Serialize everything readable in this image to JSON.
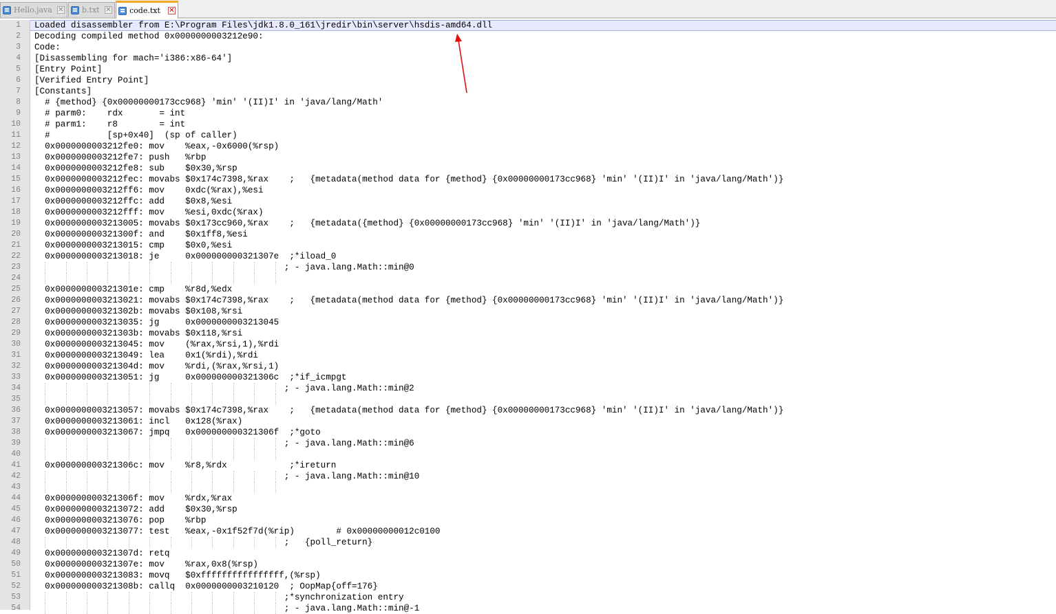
{
  "tabs": [
    {
      "label": "Hello.java",
      "active": false
    },
    {
      "label": "b.txt",
      "active": false
    },
    {
      "label": "code.txt",
      "active": true
    }
  ],
  "colors": {
    "annotation_arrow": "#e01010",
    "active_tab_accent": "#f5a623",
    "caret_line": "#e8e8ff"
  },
  "icons": {
    "file": "file-icon",
    "close": "close-x-icon"
  },
  "lines": [
    "Loaded disassembler from E:\\Program Files\\jdk1.8.0_161\\jredir\\bin\\server\\hsdis-amd64.dll",
    "Decoding compiled method 0x0000000003212e90:",
    "Code:",
    "[Disassembling for mach='i386:x86-64']",
    "[Entry Point]",
    "[Verified Entry Point]",
    "[Constants]",
    "  # {method} {0x00000000173cc968} 'min' '(II)I' in 'java/lang/Math'",
    "  # parm0:    rdx       = int",
    "  # parm1:    r8        = int",
    "  #           [sp+0x40]  (sp of caller)",
    "  0x0000000003212fe0: mov    %eax,-0x6000(%rsp)",
    "  0x0000000003212fe7: push   %rbp",
    "  0x0000000003212fe8: sub    $0x30,%rsp",
    "  0x0000000003212fec: movabs $0x174c7398,%rax    ;   {metadata(method data for {method} {0x00000000173cc968} 'min' '(II)I' in 'java/lang/Math')}",
    "  0x0000000003212ff6: mov    0xdc(%rax),%esi",
    "  0x0000000003212ffc: add    $0x8,%esi",
    "  0x0000000003212fff: mov    %esi,0xdc(%rax)",
    "  0x0000000003213005: movabs $0x173cc960,%rax    ;   {metadata({method} {0x00000000173cc968} 'min' '(II)I' in 'java/lang/Math')}",
    "  0x000000000321300f: and    $0x1ff8,%esi",
    "  0x0000000003213015: cmp    $0x0,%esi",
    "  0x0000000003213018: je     0x000000000321307e  ;*iload_0",
    "                                                ; - java.lang.Math::min@0",
    "",
    "  0x000000000321301e: cmp    %r8d,%edx",
    "  0x0000000003213021: movabs $0x174c7398,%rax    ;   {metadata(method data for {method} {0x00000000173cc968} 'min' '(II)I' in 'java/lang/Math')}",
    "  0x000000000321302b: movabs $0x108,%rsi",
    "  0x0000000003213035: jg     0x0000000003213045",
    "  0x000000000321303b: movabs $0x118,%rsi",
    "  0x0000000003213045: mov    (%rax,%rsi,1),%rdi",
    "  0x0000000003213049: lea    0x1(%rdi),%rdi",
    "  0x000000000321304d: mov    %rdi,(%rax,%rsi,1)",
    "  0x0000000003213051: jg     0x000000000321306c  ;*if_icmpgt",
    "                                                ; - java.lang.Math::min@2",
    "",
    "  0x0000000003213057: movabs $0x174c7398,%rax    ;   {metadata(method data for {method} {0x00000000173cc968} 'min' '(II)I' in 'java/lang/Math')}",
    "  0x0000000003213061: incl   0x128(%rax)",
    "  0x0000000003213067: jmpq   0x000000000321306f  ;*goto",
    "                                                ; - java.lang.Math::min@6",
    "",
    "  0x000000000321306c: mov    %r8,%rdx            ;*ireturn",
    "                                                ; - java.lang.Math::min@10",
    "",
    "  0x000000000321306f: mov    %rdx,%rax",
    "  0x0000000003213072: add    $0x30,%rsp",
    "  0x0000000003213076: pop    %rbp",
    "  0x0000000003213077: test   %eax,-0x1f52f7d(%rip)        # 0x00000000012c0100",
    "                                                ;   {poll_return}",
    "  0x000000000321307d: retq",
    "  0x000000000321307e: mov    %rax,0x8(%rsp)",
    "  0x0000000003213083: movq   $0xffffffffffffffff,(%rsp)",
    "  0x000000000321308b: callq  0x0000000003210120  ; OopMap{off=176}",
    "                                                ;*synchronization entry",
    "                                                ; - java.lang.Math::min@-1"
  ]
}
